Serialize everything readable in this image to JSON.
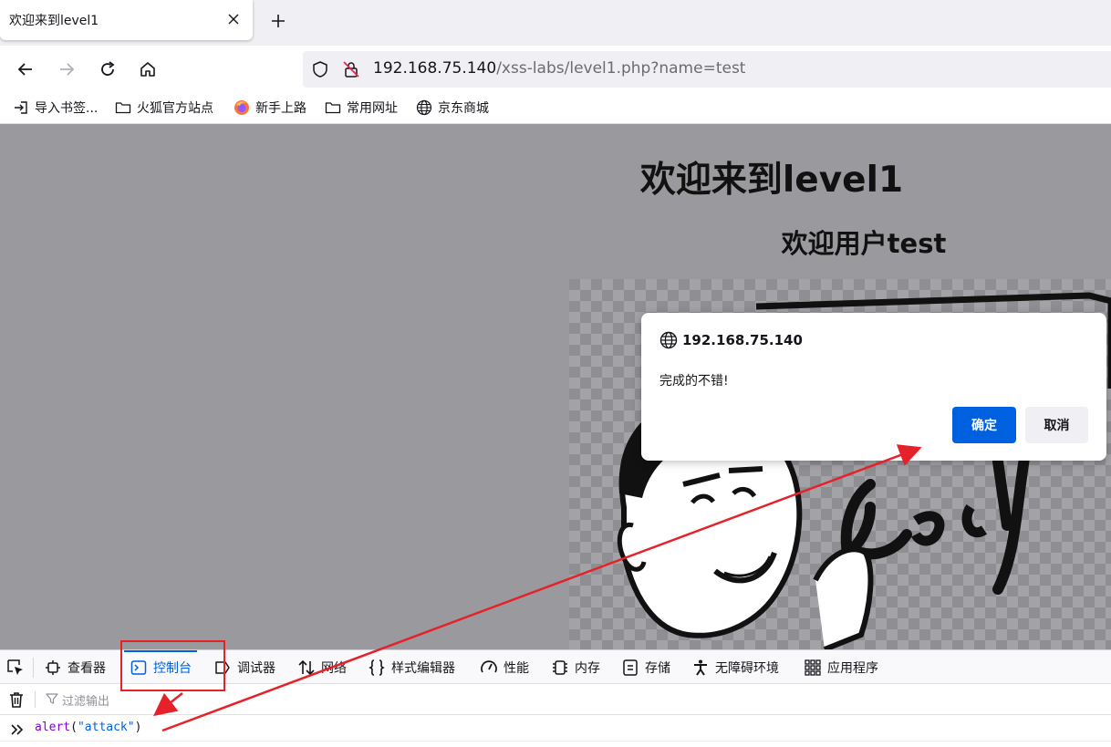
{
  "browser": {
    "tab": {
      "title": "欢迎来到level1"
    },
    "url": {
      "host": "192.168.75.140",
      "path": "/xss-labs/level1.php?name=test"
    },
    "bookmarks": [
      {
        "label": "导入书签...",
        "icon": "import-icon"
      },
      {
        "label": "火狐官方站点",
        "icon": "folder-icon"
      },
      {
        "label": "新手上路",
        "icon": "firefox-icon"
      },
      {
        "label": "常用网址",
        "icon": "folder-icon"
      },
      {
        "label": "京东商城",
        "icon": "globe-icon"
      }
    ]
  },
  "page": {
    "heading": "欢迎来到level1",
    "subheading": "欢迎用户test"
  },
  "dialog": {
    "origin": "192.168.75.140",
    "message": "完成的不错!",
    "ok_label": "确定",
    "cancel_label": "取消"
  },
  "devtools": {
    "tabs": [
      {
        "label": "查看器",
        "icon": "inspector-icon"
      },
      {
        "label": "控制台",
        "icon": "console-icon",
        "active": true
      },
      {
        "label": "调试器",
        "icon": "debugger-icon"
      },
      {
        "label": "网络",
        "icon": "network-icon"
      },
      {
        "label": "样式编辑器",
        "icon": "braces-icon"
      },
      {
        "label": "性能",
        "icon": "gauge-icon"
      },
      {
        "label": "内存",
        "icon": "memory-icon"
      },
      {
        "label": "存储",
        "icon": "storage-icon"
      },
      {
        "label": "无障碍环境",
        "icon": "accessibility-icon"
      },
      {
        "label": "应用程序",
        "icon": "grid-icon"
      }
    ],
    "filter_placeholder": "过滤输出",
    "console_input": {
      "fn": "alert",
      "open": "(",
      "arg": "\"attack\"",
      "close": ")"
    }
  },
  "colors": {
    "accent": "#0061e0",
    "annotation": "#e5222a",
    "page_background": "#9a999e"
  }
}
